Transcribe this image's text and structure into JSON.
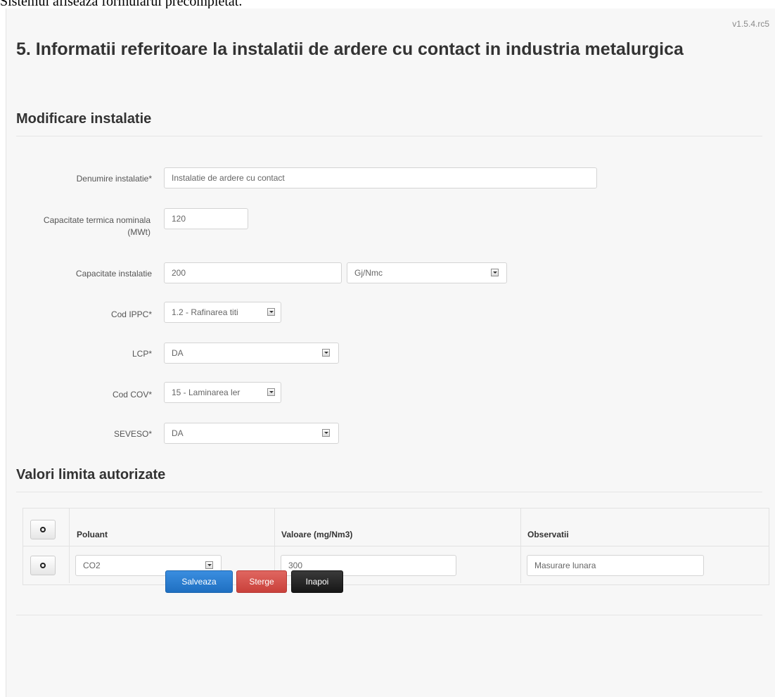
{
  "caption": "Sistemul afiseaza formularul precompletat.",
  "version": "v1.5.4.rc5",
  "page_title": "5. Informatii referitoare la instalatii de ardere cu contact in industria metalurgica",
  "section_modify": "Modificare instalatie",
  "form": {
    "denumire": {
      "label": "Denumire instalatie*",
      "value": "Instalatie de ardere cu contact"
    },
    "capacitate_termica": {
      "label": "Capacitate termica nominala (MWt)",
      "value": "120"
    },
    "capacitate_instalatie": {
      "label": "Capacitate instalatie",
      "value": "200",
      "unit": "Gj/Nmc"
    },
    "cod_ippc": {
      "label": "Cod IPPC*",
      "value": "1.2 - Rafinarea titi"
    },
    "lcp": {
      "label": "LCP*",
      "value": "DA"
    },
    "cod_cov": {
      "label": "Cod COV*",
      "value": "15 - Laminarea ler"
    },
    "seveso": {
      "label": "SEVESO*",
      "value": "DA"
    }
  },
  "section_limits": "Valori limita autorizate",
  "table": {
    "headers": [
      "Poluant",
      "Valoare (mg/Nm3)",
      "Observatii"
    ],
    "rows": [
      {
        "poluant": "CO2",
        "valoare": "300",
        "observatii": "Masurare lunara"
      }
    ]
  },
  "buttons": {
    "save": "Salveaza",
    "delete": "Sterge",
    "back": "Inapoi"
  },
  "colors": {
    "save": "#2a7fd4",
    "delete": "#d9534f",
    "back": "#222222"
  },
  "icons": {
    "add_row": "circle-icon",
    "remove_row": "circle-icon",
    "select": "select-arrow-icon"
  }
}
